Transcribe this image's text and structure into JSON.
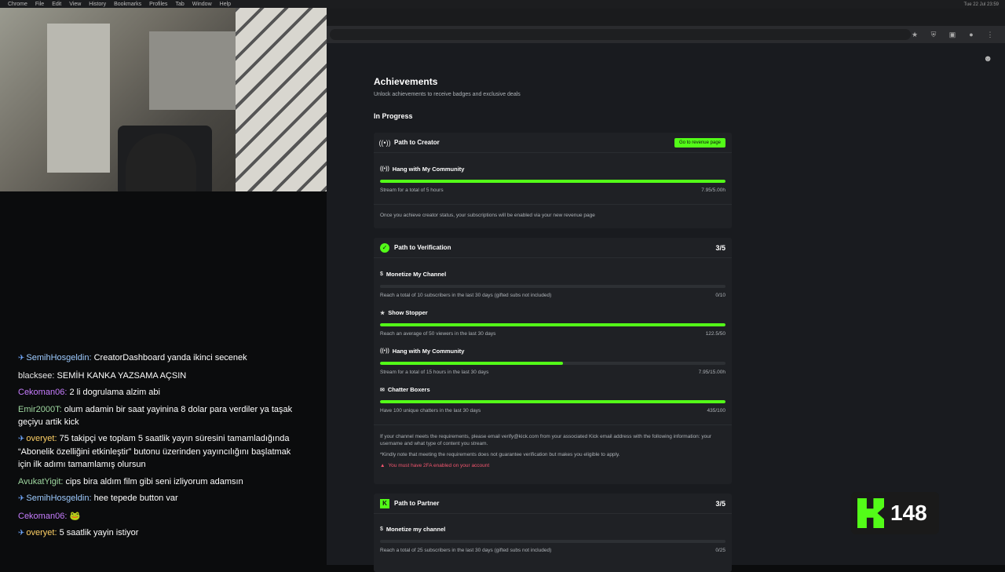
{
  "menubar": {
    "items": [
      "Chrome",
      "File",
      "Edit",
      "View",
      "History",
      "Bookmarks",
      "Profiles",
      "Tab",
      "Window",
      "Help"
    ],
    "clock": "Tue 22 Jul  23:59"
  },
  "page": {
    "title": "Achievements",
    "subtitle": "Unlock achievements to receive badges and exclusive deals",
    "in_progress_label": "In Progress"
  },
  "creator": {
    "title": "Path to Creator",
    "button": "Go to revenue page",
    "achievement": {
      "title": "Hang with My Community",
      "desc": "Stream for a total of 5 hours",
      "value": "7.95/5.00h",
      "progress": 1.0
    },
    "note": "Once you achieve creator status, your subscriptions will be enabled via your new revenue page"
  },
  "verification": {
    "title": "Path to Verification",
    "count": "3/5",
    "achievements": [
      {
        "title": "Monetize My Channel",
        "desc": "Reach a total of 10 subscribers in the last 30 days (gifted subs not included)",
        "value": "0/10",
        "progress": 0.0
      },
      {
        "title": "Show Stopper",
        "desc": "Reach an average of 50 viewers in the last 30 days",
        "value": "122.5/50",
        "progress": 1.0
      },
      {
        "title": "Hang with My Community",
        "desc": "Stream for a total of 15 hours in the last 30 days",
        "value": "7.95/15.00h",
        "progress": 0.53
      },
      {
        "title": "Chatter Boxers",
        "desc": "Have 100 unique chatters in the last 30 days",
        "value": "435/100",
        "progress": 1.0
      }
    ],
    "note1": "If your channel meets the requirements, please email verify@kick.com from your associated Kick email address with the following information: your username and what type of content you stream.",
    "note2": "*Kindly note that meeting the requirements does not guarantee verification but makes you eligible to apply.",
    "warning": "You must have 2FA enabled on your account"
  },
  "partner": {
    "title": "Path to Partner",
    "count": "3/5",
    "achievement": {
      "title": "Monetize my channel",
      "desc": "Reach a total of 25 subscribers in the last 30 days (gifted subs not included)",
      "value": "0/25",
      "progress": 0.0
    }
  },
  "chat": [
    {
      "pin": true,
      "user": "SemihHosgeldin:",
      "color": "#9ecbff",
      "text": "CreatorDashboard yanda ikinci secenek"
    },
    {
      "pin": false,
      "user": "blacksee:",
      "color": "#e6e6e6",
      "text": "SEMİH KANKA YAZSAMA AÇSIN"
    },
    {
      "pin": false,
      "user": "Cekoman06:",
      "color": "#c77dff",
      "text": "2 li dogrulama alzim abi"
    },
    {
      "pin": false,
      "user": "Emir2000T:",
      "color": "#9fd7a0",
      "text": "olum adamin bir saat yayinina 8 dolar para verdiler ya taşak geçiyu artik kick"
    },
    {
      "pin": true,
      "user": "overyet:",
      "color": "#ffd166",
      "text": "75 takipçi ve toplam 5 saatlik yayın süresini tamamladığında “Abonelik özelliğini etkinleştir” butonu üzerinden yayıncılığını başlatmak için ilk adımı tamamlamış olursun"
    },
    {
      "pin": false,
      "user": "AvukatYigit:",
      "color": "#9fd7a0",
      "text": "cips bira aldım film gibi seni izliyorum adamsın"
    },
    {
      "pin": true,
      "user": "SemihHosgeldin:",
      "color": "#9ecbff",
      "text": "hee tepede button var"
    },
    {
      "pin": false,
      "user": "Cekoman06:",
      "color": "#c77dff",
      "text": "🐸"
    },
    {
      "pin": true,
      "user": "overyet:",
      "color": "#ffd166",
      "text": "5 saatlik yayin istiyor"
    }
  ],
  "viewer_count": "148",
  "accent_color": "#53fc18"
}
